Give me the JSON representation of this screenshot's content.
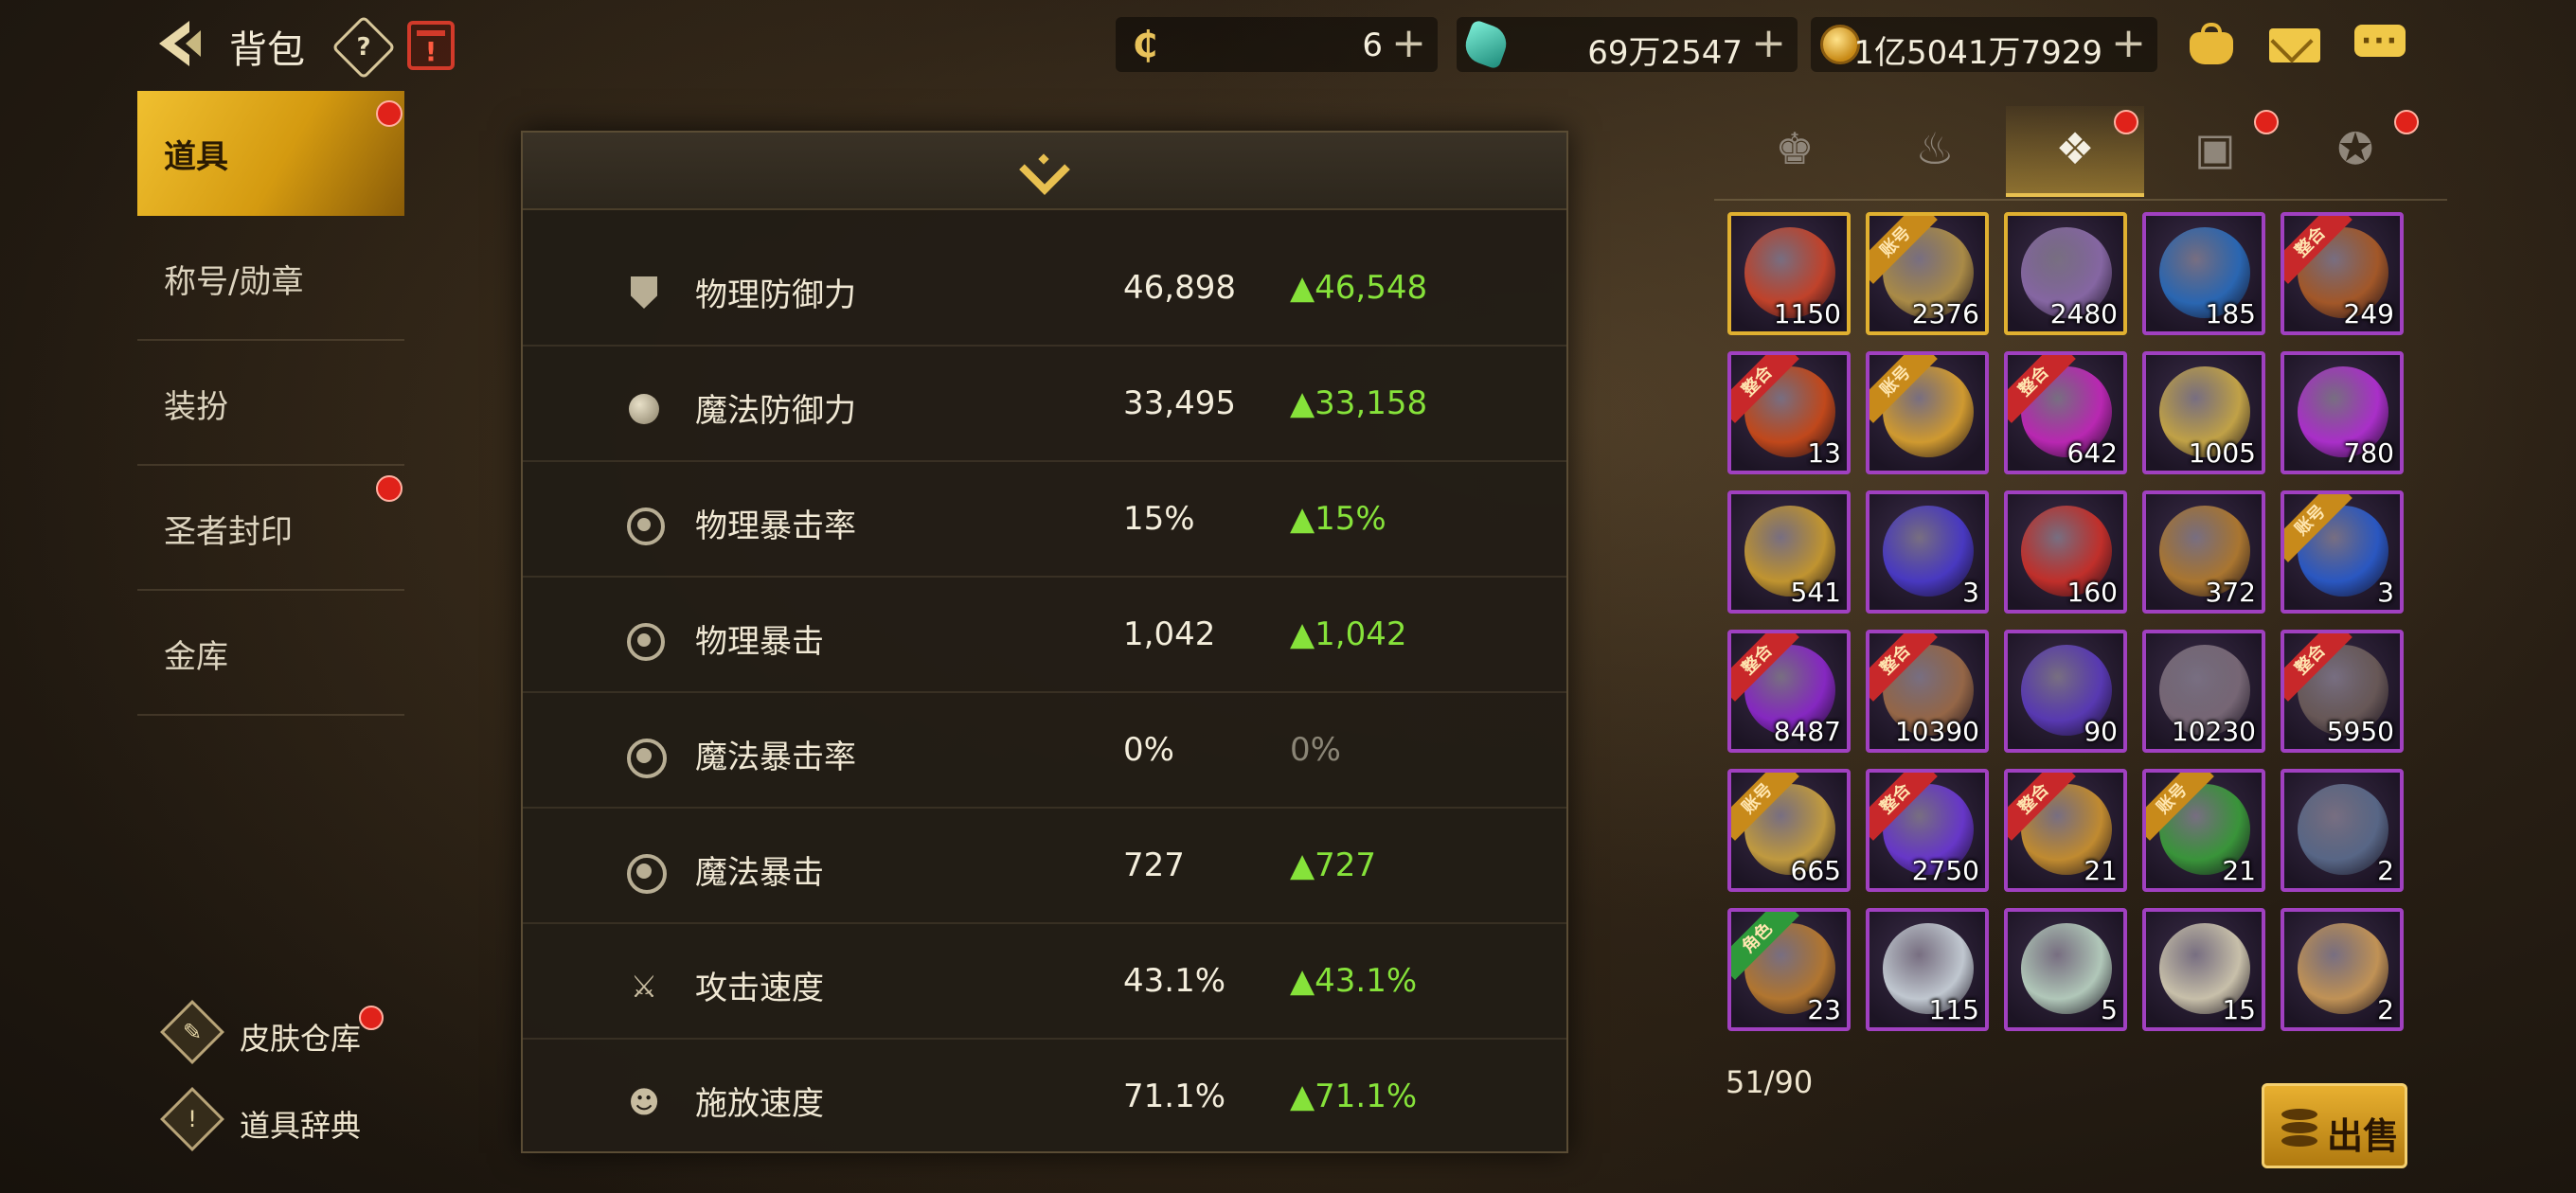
{
  "topbar": {
    "title": "背包",
    "help_label": "?",
    "calendar_label": "!",
    "currencies": [
      {
        "icon": "coupon-c-icon",
        "value": "6"
      },
      {
        "icon": "green-crystal-icon",
        "value": "69万2547"
      },
      {
        "icon": "gold-coin-icon",
        "value": "1亿5041万7929"
      }
    ],
    "plus_label": "+"
  },
  "left_menu": [
    {
      "label": "道具",
      "active": true,
      "badge": true
    },
    {
      "label": "称号/勋章",
      "active": false,
      "badge": false
    },
    {
      "label": "装扮",
      "active": false,
      "badge": false
    },
    {
      "label": "圣者封印",
      "active": false,
      "badge": true
    },
    {
      "label": "金库",
      "active": false,
      "badge": false
    }
  ],
  "bottom_links": {
    "skin_storage": {
      "label": "皮肤仓库",
      "badge": true
    },
    "item_dictionary": {
      "label": "道具辞典",
      "badge": false
    }
  },
  "stats": [
    {
      "icon": "shield-icon",
      "name": "物理防御力",
      "value": "46,898",
      "delta": "▲46,548"
    },
    {
      "icon": "orb-icon",
      "name": "魔法防御力",
      "value": "33,495",
      "delta": "▲33,158"
    },
    {
      "icon": "crosshair-icon",
      "name": "物理暴击率",
      "value": "15%",
      "delta": "▲15%"
    },
    {
      "icon": "crosshair-icon",
      "name": "物理暴击",
      "value": "1,042",
      "delta": "▲1,042"
    },
    {
      "icon": "ring-icon",
      "name": "魔法暴击率",
      "value": "0%",
      "delta": "0%"
    },
    {
      "icon": "ring-icon",
      "name": "魔法暴击",
      "value": "727",
      "delta": "▲727"
    },
    {
      "icon": "sword-icon",
      "name": "攻击速度",
      "value": "43.1%",
      "delta": "▲43.1%"
    },
    {
      "icon": "head-icon",
      "name": "施放速度",
      "value": "71.1%",
      "delta": "▲71.1%"
    }
  ],
  "category_tabs": [
    {
      "icon": "armor-icon",
      "glyph": "♚",
      "active": false,
      "badge": false
    },
    {
      "icon": "potion-icon",
      "glyph": "♨",
      "active": false,
      "badge": false
    },
    {
      "icon": "cubes-icon",
      "glyph": "❖",
      "active": true,
      "badge": true
    },
    {
      "icon": "cards-icon",
      "glyph": "▣",
      "active": false,
      "badge": true
    },
    {
      "icon": "pentagram-icon",
      "glyph": "✪",
      "active": false,
      "badge": true
    }
  ],
  "inventory": [
    {
      "qty": "1150",
      "tag": "",
      "frame": "gold",
      "color": "#c8442a"
    },
    {
      "qty": "2376",
      "tag": "账号",
      "frame": "gold",
      "color": "#b09048"
    },
    {
      "qty": "2480",
      "tag": "",
      "frame": "gold",
      "color": "#8a6aa8"
    },
    {
      "qty": "185",
      "tag": "",
      "frame": "purple",
      "color": "#2a6ab8"
    },
    {
      "qty": "249",
      "tag": "整合",
      "frame": "purple",
      "color": "#a85a28"
    },
    {
      "qty": "13",
      "tag": "整合",
      "frame": "purple",
      "color": "#c84a1a"
    },
    {
      "qty": "",
      "tag": "账号",
      "frame": "purple",
      "color": "#d8a030"
    },
    {
      "qty": "642",
      "tag": "整合",
      "frame": "purple",
      "color": "#c028b8"
    },
    {
      "qty": "1005",
      "tag": "",
      "frame": "purple",
      "color": "#c8a848"
    },
    {
      "qty": "780",
      "tag": "",
      "frame": "purple",
      "color": "#b030d0"
    },
    {
      "qty": "541",
      "tag": "",
      "frame": "purple",
      "color": "#c89a30"
    },
    {
      "qty": "3",
      "tag": "",
      "frame": "purple",
      "color": "#4a3ac8"
    },
    {
      "qty": "160",
      "tag": "",
      "frame": "purple",
      "color": "#c8302a"
    },
    {
      "qty": "372",
      "tag": "",
      "frame": "purple",
      "color": "#b07a30"
    },
    {
      "qty": "3",
      "tag": "账号",
      "frame": "purple",
      "color": "#2a5ac8"
    },
    {
      "qty": "8487",
      "tag": "整合",
      "frame": "purple",
      "color": "#8a28c8"
    },
    {
      "qty": "10390",
      "tag": "整合",
      "frame": "purple",
      "color": "#9a6a48"
    },
    {
      "qty": "90",
      "tag": "",
      "frame": "purple",
      "color": "#5a3ab8"
    },
    {
      "qty": "10230",
      "tag": "",
      "frame": "purple",
      "color": "#7a6a78"
    },
    {
      "qty": "5950",
      "tag": "整合",
      "frame": "purple",
      "color": "#6a5a58"
    },
    {
      "qty": "665",
      "tag": "账号",
      "frame": "purple",
      "color": "#c8a040"
    },
    {
      "qty": "2750",
      "tag": "整合",
      "frame": "purple",
      "color": "#6a38d0"
    },
    {
      "qty": "21",
      "tag": "整合",
      "frame": "purple",
      "color": "#c89030"
    },
    {
      "qty": "21",
      "tag": "账号",
      "frame": "purple",
      "color": "#3a9a3a"
    },
    {
      "qty": "2",
      "tag": "",
      "frame": "purple",
      "color": "#5a6a8a"
    },
    {
      "qty": "23",
      "tag": "角色",
      "frame": "purple",
      "color": "#b87a30"
    },
    {
      "qty": "115",
      "tag": "",
      "frame": "purple",
      "color": "#c8d0d8"
    },
    {
      "qty": "5",
      "tag": "",
      "frame": "purple",
      "color": "#b8d0c0"
    },
    {
      "qty": "15",
      "tag": "",
      "frame": "purple",
      "color": "#d0c8b0"
    },
    {
      "qty": "2",
      "tag": "",
      "frame": "purple",
      "color": "#c89858"
    }
  ],
  "capacity": "51/90",
  "sell_label": "出售"
}
